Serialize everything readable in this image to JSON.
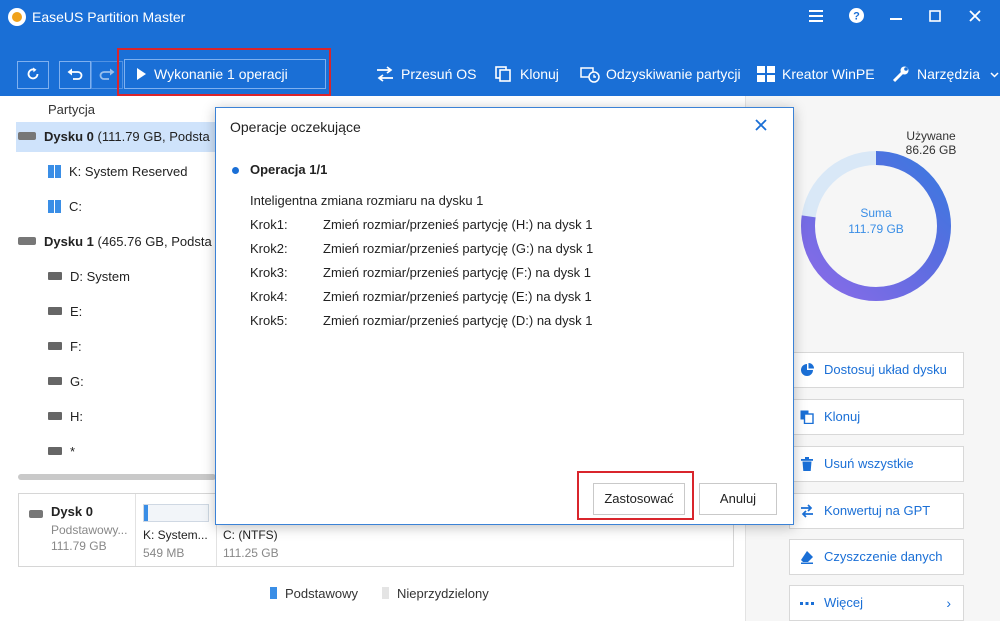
{
  "window": {
    "title": "EaseUS Partition Master",
    "icons": [
      "menu-icon",
      "help-icon",
      "minimize-icon",
      "maximize-icon",
      "close-icon"
    ]
  },
  "toolbar": {
    "execute_label": "Wykonanie 1 operacji",
    "tools": [
      {
        "label": "Przesuń OS",
        "icon": "move-os-icon"
      },
      {
        "label": "Klonuj",
        "icon": "clone-icon"
      },
      {
        "label": "Odzyskiwanie partycji",
        "icon": "partition-recovery-icon"
      },
      {
        "label": "Kreator WinPE",
        "icon": "winpe-icon"
      },
      {
        "label": "Narzędzia",
        "icon": "wrench-icon"
      }
    ]
  },
  "partition_list": {
    "column_header": "Partycja",
    "rows": [
      {
        "label": "Dysku 0",
        "detail": " (111.79 GB, Podsta",
        "type": "disk"
      },
      {
        "label": "K: System Reserved",
        "type": "windows-partition"
      },
      {
        "label": "C:",
        "type": "windows-partition"
      },
      {
        "label": "Dysku 1",
        "detail": " (465.76 GB, Podsta",
        "type": "disk"
      },
      {
        "label": "D: System",
        "type": "partition"
      },
      {
        "label": "E:",
        "type": "partition"
      },
      {
        "label": "F:",
        "type": "partition"
      },
      {
        "label": "G:",
        "type": "partition"
      },
      {
        "label": "H:",
        "type": "partition"
      },
      {
        "label": "*",
        "type": "partition"
      }
    ]
  },
  "disk_map": {
    "name": "Dysk 0",
    "type": "Podstawowy...",
    "size": "111.79 GB",
    "partitions": [
      {
        "name": "K: System...",
        "size": "549 MB"
      },
      {
        "name": "C:  (NTFS)",
        "size": "111.25 GB"
      }
    ]
  },
  "legend": [
    {
      "label": "Podstawowy",
      "color": "#3a8ee6"
    },
    {
      "label": "Nieprzydzielony",
      "color": "#e4e4e4"
    }
  ],
  "usage": {
    "used_label": "Używane",
    "used_value": "86.26 GB",
    "total_label": "Suma",
    "total_value": "111.79 GB"
  },
  "actions": [
    {
      "label": "Dostosuj układ dysku",
      "icon": "pie-chart-icon"
    },
    {
      "label": "Klonuj",
      "icon": "clone-icon"
    },
    {
      "label": "Usuń wszystkie",
      "icon": "trash-icon"
    },
    {
      "label": "Konwertuj na GPT",
      "icon": "convert-icon"
    },
    {
      "label": "Czyszczenie danych",
      "icon": "eraser-icon"
    },
    {
      "label": "Więcej",
      "icon": "more-icon"
    }
  ],
  "modal": {
    "title": "Operacje oczekujące",
    "operation_header": "Operacja 1/1",
    "operation_description": "Inteligentna zmiana rozmiaru na dysku 1",
    "steps": [
      {
        "label": "Krok1:",
        "text": "Zmień rozmiar/przenieś partycję (H:) na dysk 1"
      },
      {
        "label": "Krok2:",
        "text": "Zmień rozmiar/przenieś partycję (G:) na dysk 1"
      },
      {
        "label": "Krok3:",
        "text": "Zmień rozmiar/przenieś partycję (F:) na dysk 1"
      },
      {
        "label": "Krok4:",
        "text": "Zmień rozmiar/przenieś partycję (E:) na dysk 1"
      },
      {
        "label": "Krok5:",
        "text": "Zmień rozmiar/przenieś partycję (D:) na dysk 1"
      }
    ],
    "apply_label": "Zastosować",
    "cancel_label": "Anuluj"
  }
}
